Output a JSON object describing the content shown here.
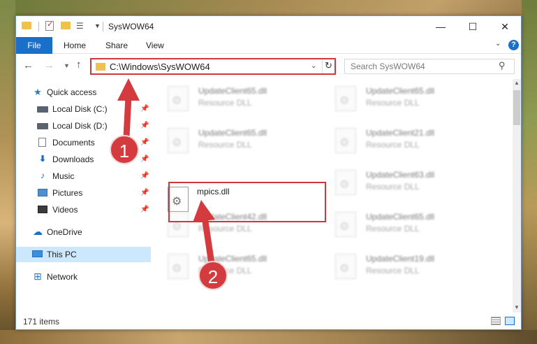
{
  "window": {
    "title": "SysWOW64",
    "controls": {
      "minimize": "—",
      "maximize": "☐",
      "close": "✕"
    }
  },
  "ribbon": {
    "tabs": [
      {
        "label": "File"
      },
      {
        "label": "Home"
      },
      {
        "label": "Share"
      },
      {
        "label": "View"
      }
    ],
    "help": "?"
  },
  "navigation": {
    "address": "C:\\Windows\\SysWOW64",
    "search_placeholder": "Search SysWOW64"
  },
  "sidebar": {
    "items": [
      {
        "label": "Quick access",
        "icon": "star-icon",
        "pinned": false
      },
      {
        "label": "Local Disk (C:)",
        "icon": "disk-icon",
        "pinned": true
      },
      {
        "label": "Local Disk (D:)",
        "icon": "disk-icon",
        "pinned": true
      },
      {
        "label": "Documents",
        "icon": "documents-icon",
        "pinned": true
      },
      {
        "label": "Downloads",
        "icon": "downloads-icon",
        "pinned": true
      },
      {
        "label": "Music",
        "icon": "music-icon",
        "pinned": true
      },
      {
        "label": "Pictures",
        "icon": "pictures-icon",
        "pinned": true
      },
      {
        "label": "Videos",
        "icon": "videos-icon",
        "pinned": true
      },
      {
        "label": "OneDrive",
        "icon": "onedrive-icon",
        "pinned": false
      },
      {
        "label": "This PC",
        "icon": "pc-icon",
        "pinned": false,
        "selected": true
      },
      {
        "label": "Network",
        "icon": "network-icon",
        "pinned": false
      }
    ]
  },
  "files": [
    {
      "name": "UpdateClient65.dll",
      "type": "Resource DLL",
      "blurred": true
    },
    {
      "name": "UpdateClient65.dll",
      "type": "Resource DLL",
      "blurred": true
    },
    {
      "name": "UpdateClient65.dll",
      "type": "Resource DLL",
      "blurred": true
    },
    {
      "name": "UpdateClient21.dll",
      "type": "Resource DLL",
      "blurred": true
    },
    {
      "name": "mpics.dll",
      "type": "",
      "blurred": false,
      "highlighted": true
    },
    {
      "name": "UpdateClient63.dll",
      "type": "Resource DLL",
      "blurred": true
    },
    {
      "name": "UpdateClient42.dll",
      "type": "Resource DLL",
      "blurred": true
    },
    {
      "name": "UpdateClient65.dll",
      "type": "Resource DLL",
      "blurred": true
    },
    {
      "name": "UpdateClient65.dll",
      "type": "Resource DLL",
      "blurred": true
    },
    {
      "name": "UpdateClient19.dll",
      "type": "Resource DLL",
      "blurred": true
    }
  ],
  "status": {
    "item_count": "171 items"
  },
  "annotations": {
    "step1": "1",
    "step2": "2",
    "color": "#d43b3f"
  }
}
